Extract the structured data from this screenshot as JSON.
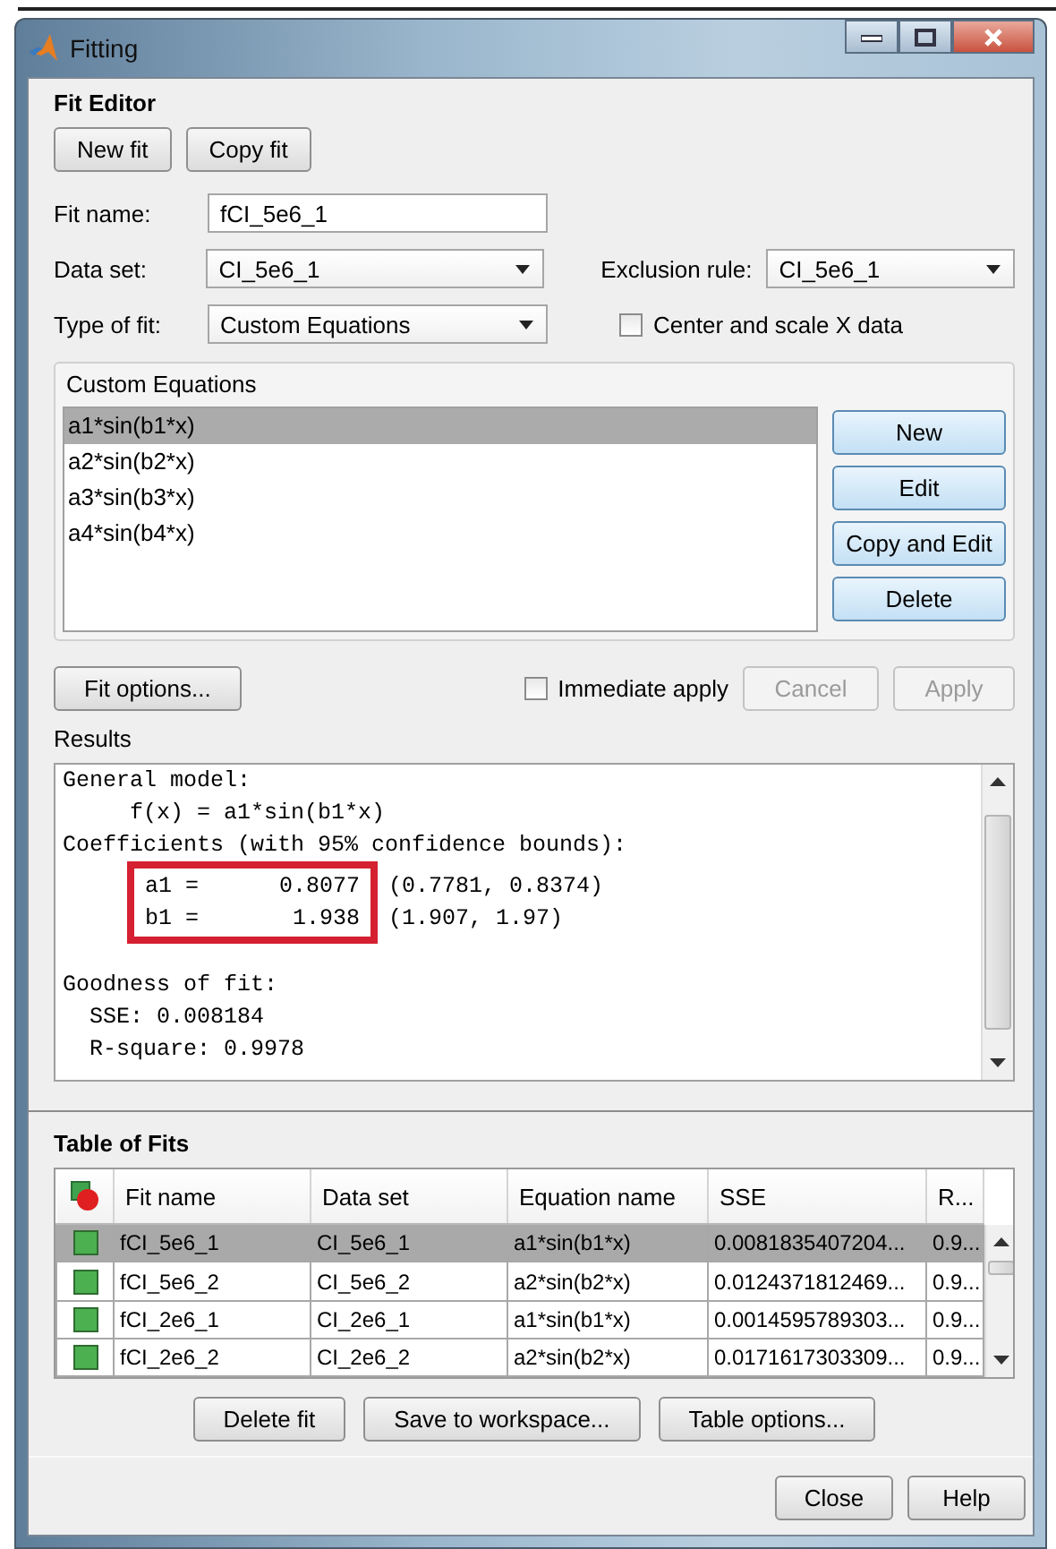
{
  "window": {
    "title": "Fitting"
  },
  "fit_editor": {
    "title": "Fit Editor",
    "buttons": [
      "New fit",
      "Copy fit"
    ],
    "fit_name": {
      "label": "Fit name:",
      "value": "fCI_5e6_1"
    },
    "data_set": {
      "label": "Data set:",
      "value": "CI_5e6_1"
    },
    "exclusion_rule": {
      "label": "Exclusion rule:",
      "value": "CI_5e6_1"
    },
    "type_of_fit": {
      "label": "Type of fit:",
      "value": "Custom Equations"
    },
    "center_scale": {
      "label": "Center and scale X data",
      "checked": false
    },
    "custom_equations": {
      "title": "Custom Equations",
      "items": [
        {
          "label": "a1*sin(b1*x)",
          "selected": true
        },
        {
          "label": "a2*sin(b2*x)",
          "selected": false
        },
        {
          "label": "a3*sin(b3*x)",
          "selected": false
        },
        {
          "label": "a4*sin(b4*x)",
          "selected": false
        }
      ],
      "buttons": [
        "New",
        "Edit",
        "Copy and Edit",
        "Delete"
      ]
    },
    "fit_options_button": "Fit options...",
    "immediate_apply": {
      "label": "Immediate apply",
      "checked": false
    },
    "action_buttons": [
      {
        "label": "Cancel",
        "disabled": true
      },
      {
        "label": "Apply",
        "disabled": true
      }
    ],
    "results": {
      "title": "Results",
      "model_lines": [
        "General model:",
        "     f(x) = a1*sin(b1*x)",
        "Coefficients (with 95% confidence bounds):"
      ],
      "coefficients": {
        "highlighted": true,
        "rows": [
          {
            "value": "a1 =      0.8077",
            "bounds": "(0.7781, 0.8374)"
          },
          {
            "value": "b1 =       1.938",
            "bounds": "(1.907, 1.97)"
          }
        ]
      },
      "goodness_lines": [
        "Goodness of fit:",
        "  SSE: 0.008184",
        "  R-square: 0.9978"
      ]
    }
  },
  "table_of_fits": {
    "title": "Table of Fits",
    "columns": [
      "Fit name",
      "Data set",
      "Equation name",
      "SSE",
      "R..."
    ],
    "rows": [
      {
        "cells": [
          "fCI_5e6_1",
          "CI_5e6_1",
          "a1*sin(b1*x)",
          "0.0081835407204...",
          "0.9..."
        ],
        "selected": true
      },
      {
        "cells": [
          "fCI_5e6_2",
          "CI_5e6_2",
          "a2*sin(b2*x)",
          "0.0124371812469...",
          "0.9..."
        ],
        "selected": false
      },
      {
        "cells": [
          "fCI_2e6_1",
          "CI_2e6_1",
          "a1*sin(b1*x)",
          "0.0014595789303...",
          "0.9..."
        ],
        "selected": false
      },
      {
        "cells": [
          "fCI_2e6_2",
          "CI_2e6_2",
          "a2*sin(b2*x)",
          "0.0171617303309...",
          "0.9..."
        ],
        "selected": false
      }
    ],
    "buttons": [
      "Delete fit",
      "Save to workspace...",
      "Table options..."
    ]
  },
  "footer_buttons": [
    "Close",
    "Help"
  ]
}
